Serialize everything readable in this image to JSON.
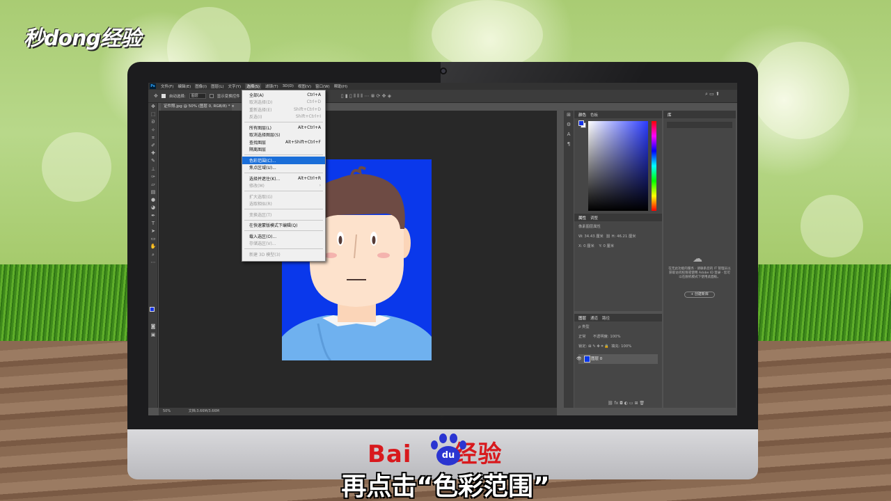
{
  "brand": {
    "text": "秒dong经验"
  },
  "baidu": {
    "text": "Bai",
    "du": "du",
    "jingyan": "经验"
  },
  "subtitle": "再点击“色彩范围”",
  "ps": {
    "app_icon": "Ps",
    "menubar": [
      "文件(F)",
      "编辑(E)",
      "图像(I)",
      "图层(L)",
      "文字(Y)",
      "选择(S)",
      "滤镜(T)",
      "3D(D)",
      "视图(V)",
      "窗口(W)",
      "帮助(H)"
    ],
    "active_menu_index": 5,
    "options": {
      "auto_select_label": "自动选择:",
      "auto_select_value": "图层",
      "show_transform": "显示变换控件"
    },
    "doc_tab": "证件照.jpg @ 50% (图层 0, RGB/8) *",
    "status": {
      "zoom": "50%",
      "doc": "文档:3.66M/3.66M"
    },
    "select_menu": [
      {
        "label": "全部(A)",
        "shortcut": "Ctrl+A",
        "disabled": false
      },
      {
        "label": "取消选择(D)",
        "shortcut": "Ctrl+D",
        "disabled": true
      },
      {
        "label": "重新选择(E)",
        "shortcut": "Shift+Ctrl+D",
        "disabled": true
      },
      {
        "label": "反选(I)",
        "shortcut": "Shift+Ctrl+I",
        "disabled": true
      },
      {
        "sep": true
      },
      {
        "label": "所有图层(L)",
        "shortcut": "Alt+Ctrl+A",
        "disabled": false
      },
      {
        "label": "取消选择图层(S)",
        "shortcut": "",
        "disabled": false
      },
      {
        "label": "查找图层",
        "shortcut": "Alt+Shift+Ctrl+F",
        "disabled": false
      },
      {
        "label": "隔离图层",
        "shortcut": "",
        "disabled": false
      },
      {
        "sep": true
      },
      {
        "label": "色彩范围(C)...",
        "shortcut": "",
        "disabled": false,
        "highlight": true
      },
      {
        "label": "焦点区域(U)...",
        "shortcut": "",
        "disabled": false
      },
      {
        "sep": true
      },
      {
        "label": "选择并遮住(K)...",
        "shortcut": "Alt+Ctrl+R",
        "disabled": false
      },
      {
        "label": "修改(M)",
        "shortcut": "›",
        "disabled": true
      },
      {
        "sep": true
      },
      {
        "label": "扩大选取(G)",
        "shortcut": "",
        "disabled": true
      },
      {
        "label": "选取相似(R)",
        "shortcut": "",
        "disabled": true
      },
      {
        "sep": true
      },
      {
        "label": "变换选区(T)",
        "shortcut": "",
        "disabled": true
      },
      {
        "sep": true
      },
      {
        "label": "在快速蒙版模式下编辑(Q)",
        "shortcut": "",
        "disabled": false
      },
      {
        "sep": true
      },
      {
        "label": "载入选区(O)...",
        "shortcut": "",
        "disabled": false
      },
      {
        "label": "存储选区(V)...",
        "shortcut": "",
        "disabled": true
      },
      {
        "sep": true
      },
      {
        "label": "新建 3D 模型(3)",
        "shortcut": "",
        "disabled": true
      }
    ],
    "color_panel": {
      "tab1": "颜色",
      "tab2": "色板",
      "fg_color": "#1432e6",
      "bg_color": "#ffffff"
    },
    "props_panel": {
      "tab1": "属性",
      "tab2": "调整",
      "title": "像素图层属性",
      "w": "W: 34.43 厘米",
      "h": "H: 46.21 厘米",
      "x": "X: 0 厘米",
      "y": "Y: 0 厘米"
    },
    "layers_panel": {
      "tab1": "图层",
      "tab2": "通道",
      "tab3": "路径",
      "kind": "ρ 类型",
      "blend": "正常",
      "opacity_label": "不透明度:",
      "opacity": "100%",
      "lock_label": "锁定:",
      "fill_label": "填充:",
      "fill": "100%",
      "layer_name": "图层 0"
    },
    "library_panel": {
      "tab": "库",
      "text": "在无此功能的服务 · 请联系您的 IT 管理员以获取访问权限或使用 Adobe ID 登录 · 您可以在脱机模式下使用此面板。",
      "button": "+ 创建新库"
    },
    "photo_bg_color": "#0a38eb"
  }
}
